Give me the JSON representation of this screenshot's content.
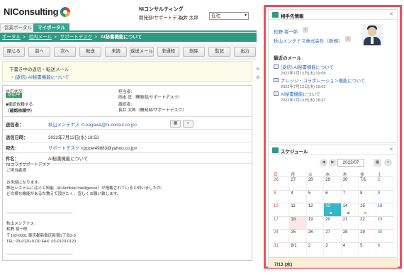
{
  "header": {
    "logo_text": "NIConsulting",
    "company": "NIコンサルティング",
    "department": "開発部/サポートデスク",
    "user": "長井 太郎",
    "status_select": "在社"
  },
  "tabs": [
    {
      "label": "営業ポータル"
    },
    {
      "label": "マイポータル"
    }
  ],
  "breadcrumb": {
    "items": [
      "ポータル",
      "社内メール",
      "サポートデスク"
    ],
    "current": "AI秘書機能について"
  },
  "toolbar": {
    "buttons": [
      "閉じる",
      "前へ",
      "次へ",
      "転送",
      "未読",
      "返送メール",
      "非通知",
      "削除",
      "監記",
      "出力"
    ]
  },
  "drafts": {
    "title": "下書き中の返信・転送メール",
    "item": "・(返信) AI秘書機能について"
  },
  "splitter": {
    "arrow": "⊪",
    "gear": "⚙"
  },
  "meta": {
    "status_label": "対応状況：",
    "status_value": "対応中",
    "check1": "■確認依頼する",
    "check2": "（確認依頼中）",
    "assignee_label": "担当者：",
    "assignee_value": "岡本 亘（開発部/サポートデスク）",
    "confirmer_label": "確認者：",
    "confirmer_value": "長井 太郎（開発部/サポートデスク）"
  },
  "fields": {
    "from_label": "送信者：",
    "from_value": "秋山メンテナス <t-kagawa@ni-consul.co.jp>",
    "date_label": "送信日時：",
    "date_value": "2022年7月13日(水) 18:53",
    "to_label": "宛先：",
    "to_link": "サポートデスク",
    "to_email": " <jzpow49883@yahoo.co.jp>",
    "subject_label": "件名：",
    "subject_value": "AI秘書機能について"
  },
  "body": "NIコラボサポートデスク\nご担当者様\n\nお世話になります。\n弊社システムには人工知能（AI Artificial Intelligence）が搭載されていると伺いましたが、\nどの様な機能があるか教えて頂きたく、宜しくお願い致します。\n\n\n______________________________\n\n秋山メンテナス\n松野 将一郎\n〒162-0001 東京都新宿区新宿1丁目2-3\nTEL: 03-0120-0120 FAX: 03-0120-0120\n\n______________________________",
  "contact": {
    "title": "相手先情報",
    "name": "松野 将一郎",
    "company": "秋山メンテナス株式会社（新規）",
    "info_icon": "i",
    "recent_title": "最近のメール",
    "recent": [
      {
        "subject": "(返信) AI秘書機能について",
        "date": "2022年7月13日(水) 19:08"
      },
      {
        "subject": "ナレッジ・コラボレーション機能について",
        "date": "2022年7月13日(水) 19:02"
      },
      {
        "subject": "AI秘書機能について",
        "date": "2022年7月13日(水) 18:47"
      }
    ]
  },
  "schedule": {
    "title": "スケジュール",
    "month": "2022/07",
    "dow": [
      "日",
      "月",
      "火",
      "水",
      "木",
      "金",
      "土"
    ],
    "weeks": [
      [
        "26",
        "27",
        "28",
        "29",
        "30",
        "7/1",
        "2"
      ],
      [
        "3",
        "4",
        "5",
        "6",
        "7",
        "8",
        "9"
      ],
      [
        "10",
        "11",
        "12",
        "13",
        "14",
        "15",
        "16"
      ],
      [
        "17",
        "18",
        "19",
        "20",
        "21",
        "22",
        "23"
      ],
      [
        "24",
        "25",
        "26",
        "27",
        "28",
        "29",
        "30"
      ],
      [
        "31",
        "8/1",
        "2",
        "3",
        "4",
        "5",
        "6"
      ]
    ],
    "selected_label": "7/13 (水)",
    "colors": {
      "today": "#33b7c9",
      "holiday": "#fbe6ea",
      "dot_green": "#2fa65a",
      "dot_orange": "#f0a428"
    }
  }
}
